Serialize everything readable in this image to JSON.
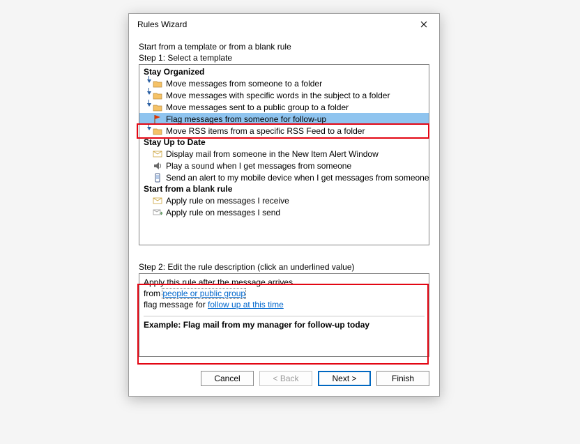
{
  "dialog": {
    "title": "Rules Wizard",
    "intro": "Start from a template or from a blank rule",
    "step1_label": "Step 1: Select a template",
    "groups": {
      "g1": "Stay Organized",
      "g2": "Stay Up to Date",
      "g3": "Start from a blank rule"
    },
    "items": {
      "i1": "Move messages from someone to a folder",
      "i2": "Move messages with specific words in the subject to a folder",
      "i3": "Move messages sent to a public group to a folder",
      "i4": "Flag messages from someone for follow-up",
      "i5": "Move RSS items from a specific RSS Feed to a folder",
      "i6": "Display mail from someone in the New Item Alert Window",
      "i7": "Play a sound when I get messages from someone",
      "i8": "Send an alert to my mobile device when I get messages from someone",
      "i9": "Apply rule on messages I receive",
      "i10": "Apply rule on messages I send"
    },
    "step2_label": "Step 2: Edit the rule description (click an underlined value)",
    "desc": {
      "line1": "Apply this rule after the message arrives",
      "from_prefix": "from ",
      "from_link": "people or public group",
      "flag_prefix": "flag message for ",
      "flag_link": "follow up at this time",
      "example": "Example: Flag mail from my manager for follow-up today"
    },
    "buttons": {
      "cancel": "Cancel",
      "back": "< Back",
      "next": "Next >",
      "finish": "Finish"
    }
  }
}
